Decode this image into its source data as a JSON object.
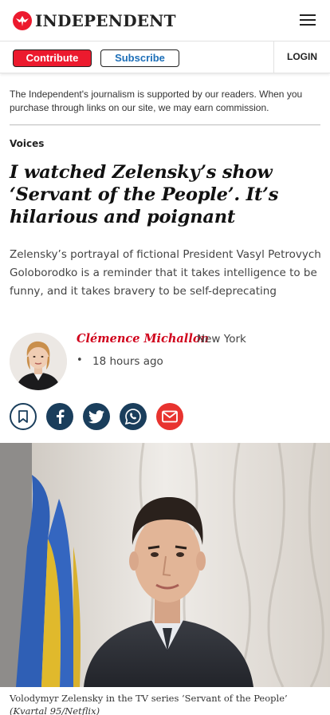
{
  "header": {
    "logo_text": "INDEPENDENT",
    "brand_color": "#ec1a2e"
  },
  "subnav": {
    "contribute_label": "Contribute",
    "subscribe_label": "Subscribe",
    "login_label": "LOGIN"
  },
  "disclaimer": "The Independent's journalism is supported by our readers. When you purchase through links on our site, we may earn commission.",
  "article": {
    "section": "Voices",
    "headline": "I watched Zelensky’s show ‘Servant of the People’. It’s hilarious and poignant",
    "standfirst": "Zelensky’s portrayal of fictional President Vasyl Petrovych Goloborodko is a reminder that it takes intelligence to be funny, and it takes bravery to be self-deprecating",
    "author": {
      "name": "Clémence Michallon",
      "location": "New York",
      "separator": "•",
      "time": "18 hours ago"
    },
    "share_icons": [
      "bookmark-icon",
      "facebook-icon",
      "twitter-icon",
      "whatsapp-icon",
      "email-icon"
    ],
    "image": {
      "caption": "Volodymyr Zelensky in the TV series ‘Servant of the People’",
      "credit": "(Kvartal 95/Netflix)"
    }
  },
  "colors": {
    "share_bg": "#1a3e5c",
    "email_bg": "#e8332f",
    "author_name": "#d0021b",
    "subscribe_text": "#1d6fb8"
  }
}
